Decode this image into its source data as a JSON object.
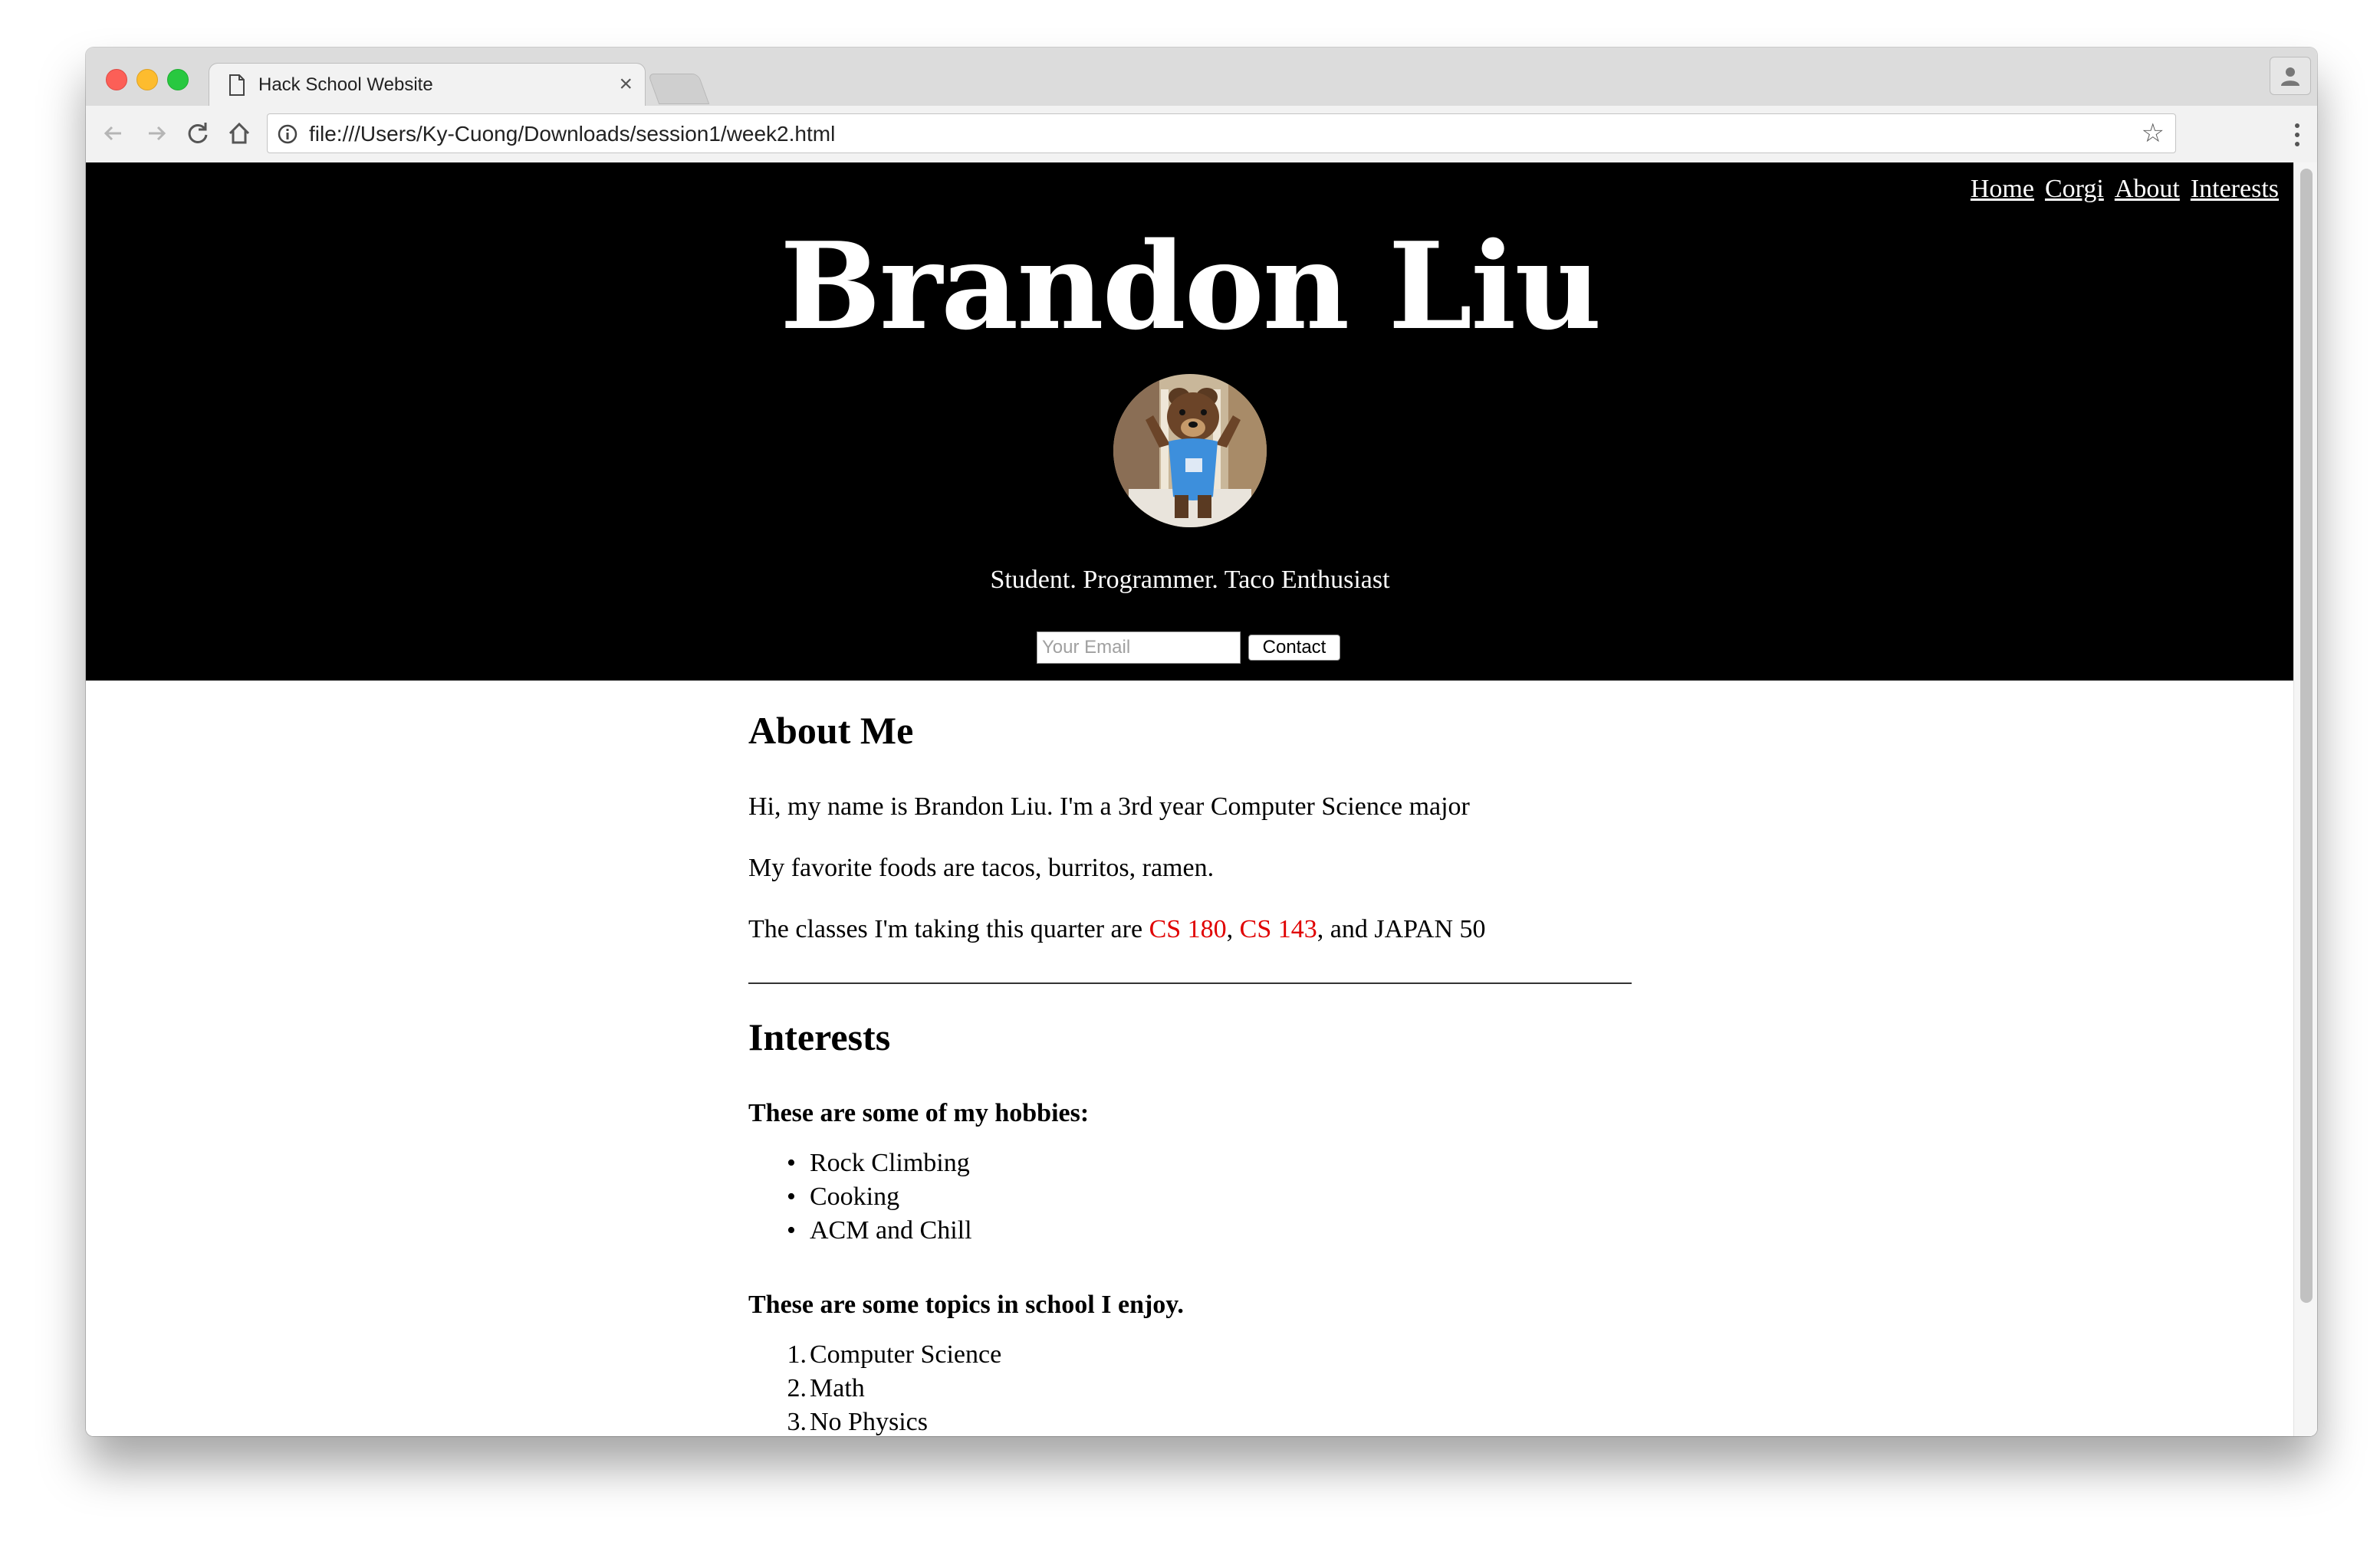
{
  "browser": {
    "tab_title": "Hack School Website",
    "tab_close": "×",
    "url": "file:///Users/Ky-Cuong/Downloads/session1/week2.html"
  },
  "page": {
    "nav": [
      "Home",
      "Corgi",
      "About",
      "Interests"
    ],
    "name": "Brandon Liu",
    "tagline": "Student. Programmer. Taco Enthusiast",
    "email_placeholder": "Your Email",
    "contact_label": "Contact",
    "about": {
      "heading": "About Me",
      "p1": "Hi, my name is Brandon Liu. I'm a 3rd year Computer Science major",
      "p2": "My favorite foods are tacos, burritos, ramen.",
      "p3_prefix": "The classes I'm taking this quarter are ",
      "course1": "CS 180",
      "sep": ", ",
      "course2": "CS 143",
      "p3_suffix": ", and JAPAN 50"
    },
    "interests": {
      "heading": "Interests",
      "hobbies_intro": "These are some of my hobbies:",
      "hobbies": [
        "Rock Climbing",
        "Cooking",
        "ACM and Chill"
      ],
      "topics_intro": "These are some topics in school I enjoy.",
      "topics": [
        "Computer Science",
        "Math",
        "No Physics"
      ]
    }
  },
  "colors": {
    "hero_bg": "#000000",
    "link_red": "#e00000"
  }
}
